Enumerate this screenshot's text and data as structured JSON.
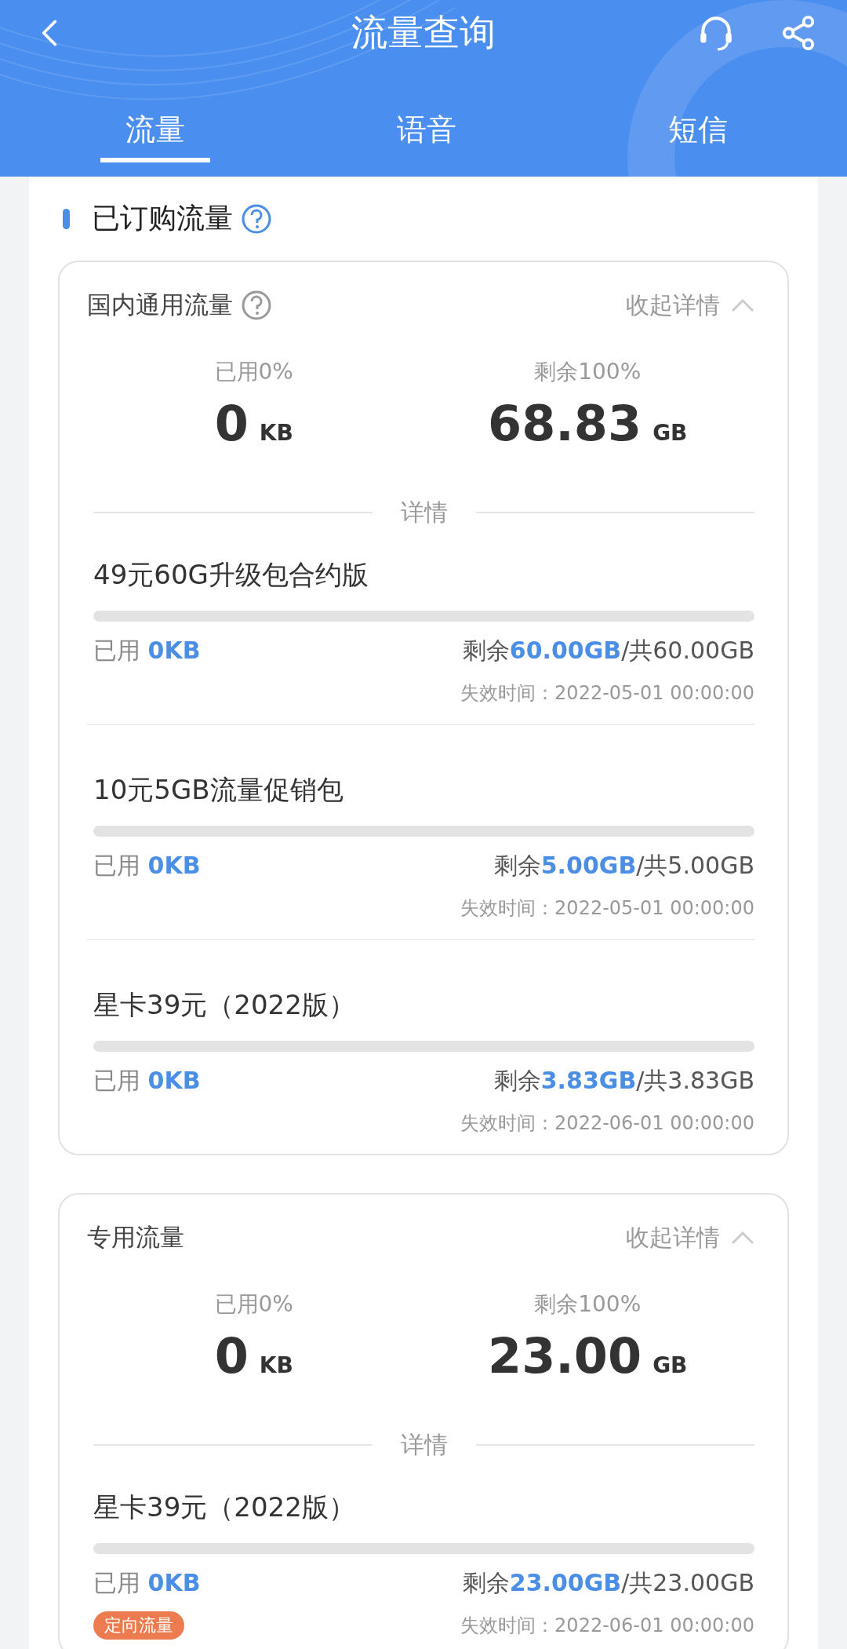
{
  "header": {
    "title": "流量查询"
  },
  "tabs": [
    {
      "label": "流量",
      "selected": true
    },
    {
      "label": "语音",
      "selected": false
    },
    {
      "label": "短信",
      "selected": false
    }
  ],
  "section": {
    "title": "已订购流量"
  },
  "cards": [
    {
      "title": "国内通用流量",
      "help": true,
      "toggle": "收起详情",
      "used": {
        "label": "已用0%",
        "value": "0",
        "unit": "KB"
      },
      "remaining": {
        "label": "剩余100%",
        "value": "68.83",
        "unit": "GB"
      },
      "divider": "详情",
      "items": [
        {
          "name": "49元60G升级包合约版",
          "level": 0,
          "used_label": "已用",
          "used_value": "0KB",
          "remain_label": "剩余",
          "remain_value": "60.00GB",
          "total": "/共60.00GB",
          "expiry": "失效时间：2022-05-01 00:00:00"
        },
        {
          "name": "10元5GB流量促销包",
          "level": 0,
          "used_label": "已用",
          "used_value": "0KB",
          "remain_label": "剩余",
          "remain_value": "5.00GB",
          "total": "/共5.00GB",
          "expiry": "失效时间：2022-05-01 00:00:00"
        },
        {
          "name": "星卡39元（2022版）",
          "level": 0,
          "used_label": "已用",
          "used_value": "0KB",
          "remain_label": "剩余",
          "remain_value": "3.83GB",
          "total": "/共3.83GB",
          "expiry": "失效时间：2022-06-01 00:00:00"
        }
      ]
    },
    {
      "title": "专用流量",
      "help": false,
      "toggle": "收起详情",
      "used": {
        "label": "已用0%",
        "value": "0",
        "unit": "KB"
      },
      "remaining": {
        "label": "剩余100%",
        "value": "23.00",
        "unit": "GB"
      },
      "divider": "详情",
      "items": [
        {
          "name": "星卡39元（2022版）",
          "level": 0,
          "used_label": "已用",
          "used_value": "0KB",
          "remain_label": "剩余",
          "remain_value": "23.00GB",
          "total": "/共23.00GB",
          "expiry": "失效时间：2022-06-01 00:00:00",
          "tag": "定向流量"
        }
      ]
    }
  ]
}
